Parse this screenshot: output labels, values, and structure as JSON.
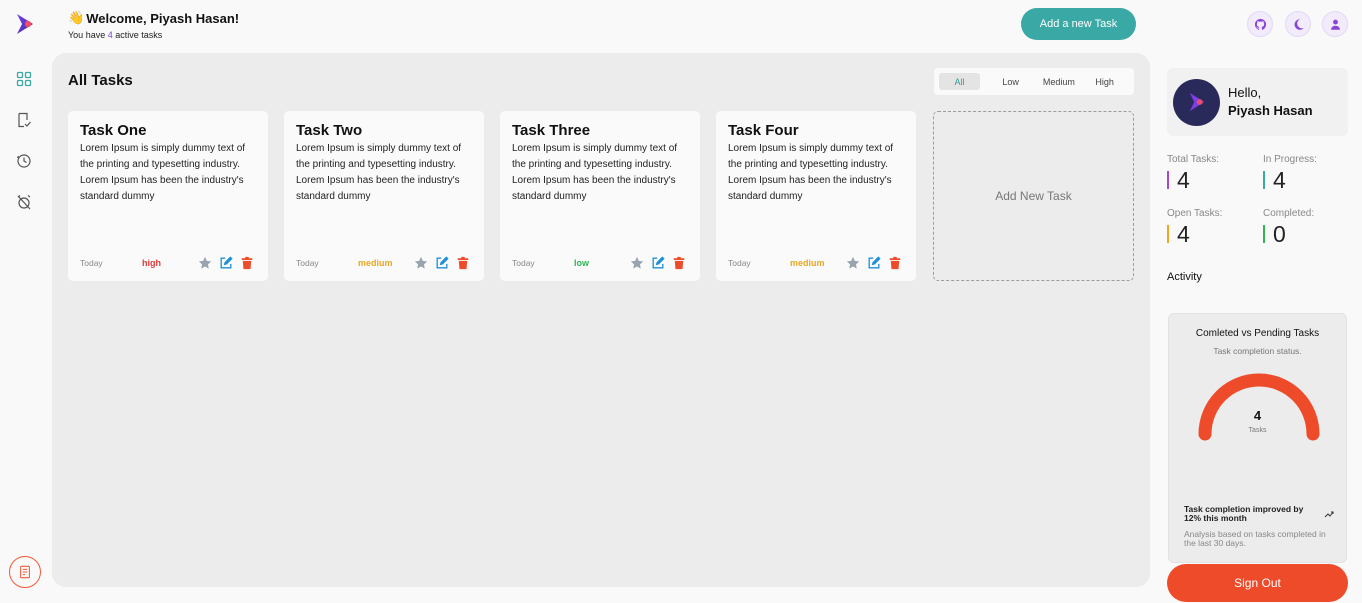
{
  "header": {
    "wave_emoji": "👋",
    "welcome_text": "Welcome, Piyash Hasan!",
    "active_prefix": "You have ",
    "active_count": "4",
    "active_suffix": " active tasks",
    "add_task_label": "Add a new Task"
  },
  "top_icons": [
    "github-icon",
    "moon-icon",
    "user-icon"
  ],
  "sidebar": {
    "items": [
      {
        "name": "dashboard-icon"
      },
      {
        "name": "tasks-icon"
      },
      {
        "name": "clock-icon"
      },
      {
        "name": "alarm-off-icon"
      }
    ]
  },
  "main": {
    "title": "All Tasks",
    "filters": [
      "All",
      "Low",
      "Medium",
      "High"
    ],
    "active_filter": "All",
    "tasks": [
      {
        "title": "Task One",
        "description": "Lorem Ipsum is simply dummy text of the printing and typesetting industry. Lorem Ipsum has been the industry's standard dummy",
        "date": "Today",
        "priority": "high"
      },
      {
        "title": "Task Two",
        "description": "Lorem Ipsum is simply dummy text of the printing and typesetting industry. Lorem Ipsum has been the industry's standard dummy",
        "date": "Today",
        "priority": "medium"
      },
      {
        "title": "Task Three",
        "description": "Lorem Ipsum is simply dummy text of the printing and typesetting industry. Lorem Ipsum has been the industry's standard dummy",
        "date": "Today",
        "priority": "low"
      },
      {
        "title": "Task Four",
        "description": "Lorem Ipsum is simply dummy text of the printing and typesetting industry. Lorem Ipsum has been the industry's standard dummy",
        "date": "Today",
        "priority": "medium"
      }
    ],
    "add_new_label": "Add New Task"
  },
  "profile": {
    "greeting": "Hello,",
    "name": "Piyash Hasan"
  },
  "stats": {
    "total": {
      "label": "Total Tasks:",
      "value": "4",
      "color": "#a64ac9"
    },
    "in_progress": {
      "label": "In Progress:",
      "value": "4",
      "color": "#3aa8a5"
    },
    "open": {
      "label": "Open Tasks:",
      "value": "4",
      "color": "#e9a820"
    },
    "completed": {
      "label": "Completed:",
      "value": "0",
      "color": "#2fb653"
    }
  },
  "activity": {
    "label": "Activity",
    "chart_title": "Comleted vs Pending Tasks",
    "chart_subtitle": "Task completion status.",
    "gauge_value": "4",
    "gauge_unit": "Tasks",
    "gauge_color": "#ee4b2b",
    "trend_text": "Task completion improved by 12% this month",
    "trend_note": "Analysis based on tasks completed in the last 30 days."
  },
  "signout_label": "Sign Out",
  "colors": {
    "accent": "#3aa8a5",
    "danger": "#ee4b2b",
    "brand": "#7b3fe4"
  }
}
